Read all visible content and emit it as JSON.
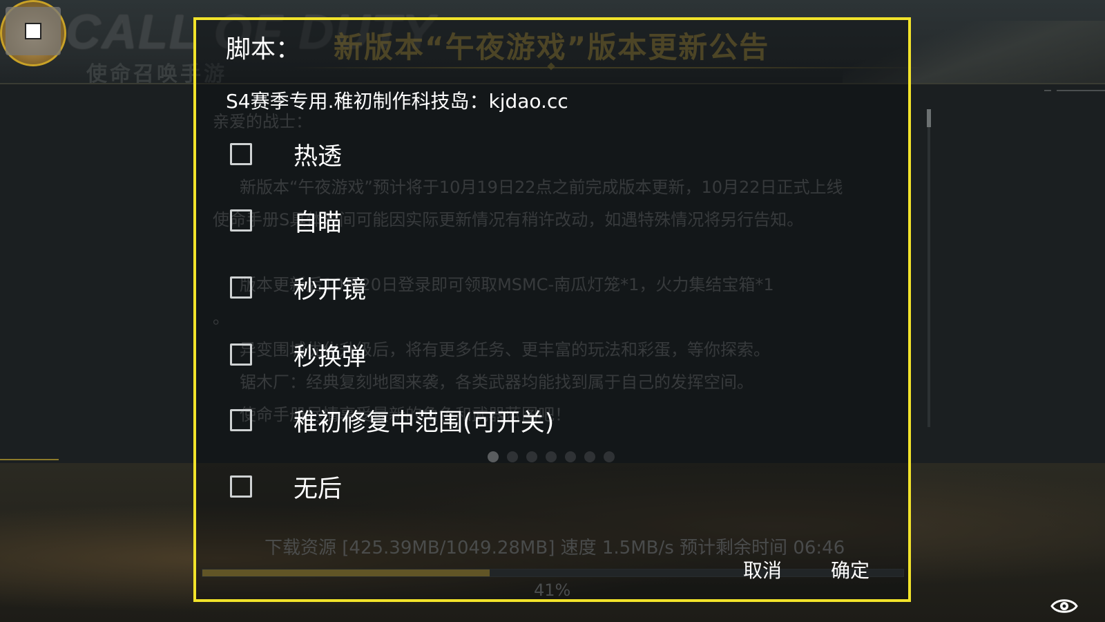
{
  "background": {
    "logo_text": "CALL OF DUTY",
    "logo_subtitle": "使命召唤手游",
    "announcement": {
      "title": "新版本“午夜游戏”版本更新公告",
      "greeting": "亲爱的战士：",
      "lines": [
        "新版本“午夜游戏”预计将于10月19日22点之前完成版本更新，10月22日正式上线",
        "使命手册S具体时间可能因实际更新情况有稍许改动，如遇特殊情况将另行告知。",
        "版本更新后10月20日登录即可领取MSMC-南瓜灯笼*1，火力集结宝箱*1",
        "。",
        "异变围城优化升级后，将有更多任务、更丰富的玩法和彩蛋，等你探索。",
        "锯木厂：经典复刻地图来袭，各类武器均能找到属于自己的发挥空间。",
        "使命手册尽情享受最新的角色和武器蓝图吧！"
      ]
    },
    "pager_dots": 7,
    "pager_active": 0,
    "download_info": "下载资源 [425.39MB/1049.28MB] 速度 1.5MB/s  预计剩余时间 06:46",
    "progress_percent": 41,
    "progress_label": "41%"
  },
  "dialog": {
    "title": "脚本：",
    "subtitle": "S4赛季专用.稚初制作科技岛：kjdao.cc",
    "options": [
      {
        "label": "热透",
        "checked": false
      },
      {
        "label": "自瞄",
        "checked": false
      },
      {
        "label": "秒开镜",
        "checked": false
      },
      {
        "label": "秒换弹",
        "checked": false
      },
      {
        "label": "稚初修复中范围(可开关)",
        "checked": false
      },
      {
        "label": "无后",
        "checked": false
      }
    ],
    "cancel_label": "取消",
    "confirm_label": "确定"
  },
  "colors": {
    "dialog_border": "#f2e32a",
    "gold_accent": "#c5a53f"
  }
}
